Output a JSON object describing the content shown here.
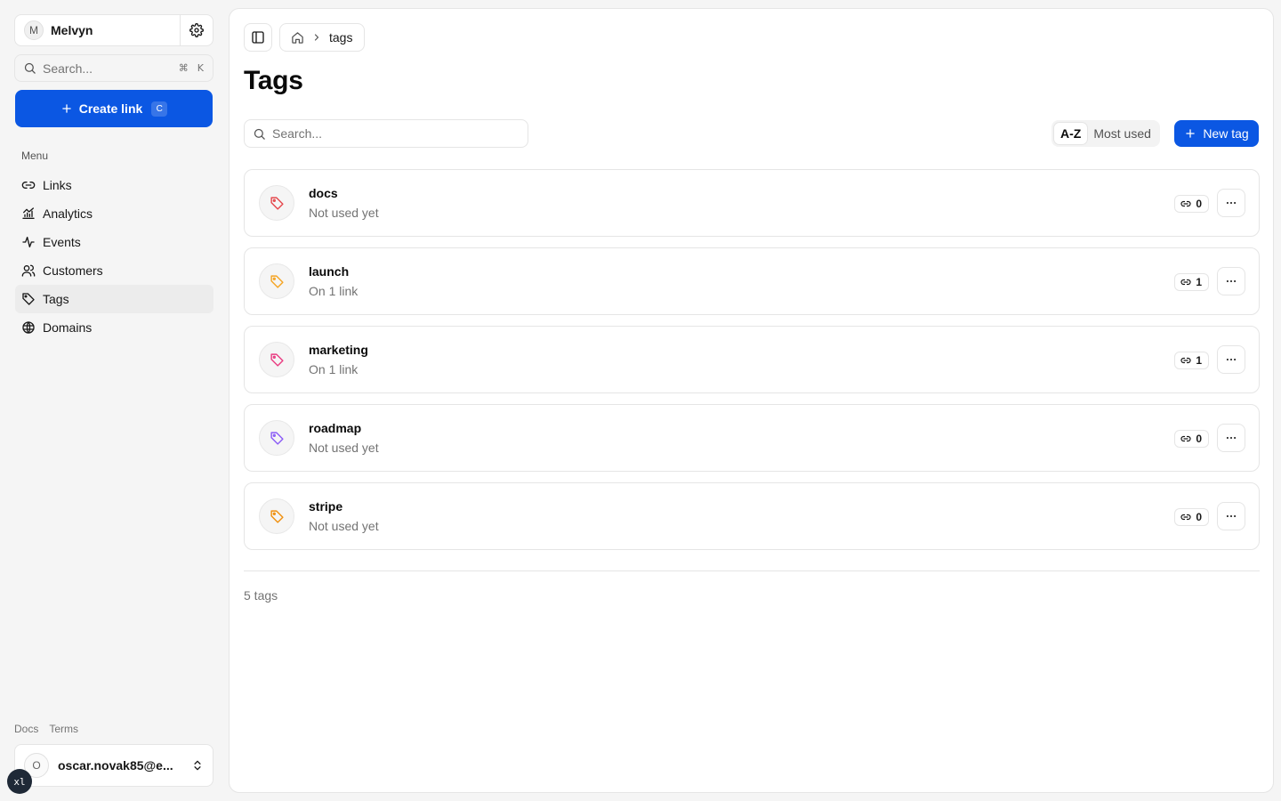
{
  "workspace": {
    "initial": "M",
    "name": "Melvyn"
  },
  "sidebar_search": {
    "placeholder": "Search...",
    "shortcut_mod": "⌘",
    "shortcut_key": "K"
  },
  "create_link": {
    "label": "Create link",
    "shortcut": "C"
  },
  "menu": {
    "heading": "Menu",
    "items": [
      {
        "label": "Links",
        "icon": "link-icon",
        "active": false
      },
      {
        "label": "Analytics",
        "icon": "analytics-icon",
        "active": false
      },
      {
        "label": "Events",
        "icon": "activity-icon",
        "active": false
      },
      {
        "label": "Customers",
        "icon": "users-icon",
        "active": false
      },
      {
        "label": "Tags",
        "icon": "tag-icon",
        "active": true
      },
      {
        "label": "Domains",
        "icon": "globe-icon",
        "active": false
      }
    ]
  },
  "footer_links": {
    "docs": "Docs",
    "terms": "Terms"
  },
  "user": {
    "initial": "O",
    "email": "oscar.novak85@e..."
  },
  "dev_badge": "xl",
  "breadcrumb": {
    "current": "tags"
  },
  "page": {
    "title": "Tags"
  },
  "tag_search": {
    "placeholder": "Search..."
  },
  "sort": {
    "options": [
      "A-Z",
      "Most used"
    ],
    "selected": "A-Z"
  },
  "new_tag": {
    "label": "New tag"
  },
  "tags": [
    {
      "name": "docs",
      "subtitle": "Not used yet",
      "count": "0",
      "color": "#e5484d"
    },
    {
      "name": "launch",
      "subtitle": "On 1 link",
      "count": "1",
      "color": "#f5a524"
    },
    {
      "name": "marketing",
      "subtitle": "On 1 link",
      "count": "1",
      "color": "#e93d82"
    },
    {
      "name": "roadmap",
      "subtitle": "Not used yet",
      "count": "0",
      "color": "#8b5cf6"
    },
    {
      "name": "stripe",
      "subtitle": "Not used yet",
      "count": "0",
      "color": "#f0900f"
    }
  ],
  "summary": "5 tags",
  "colors": {
    "accent": "#0b57e3"
  }
}
